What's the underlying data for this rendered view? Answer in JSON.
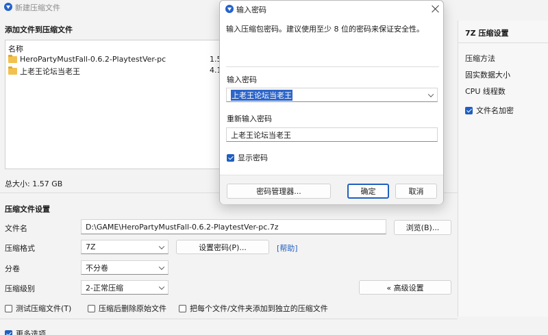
{
  "window": {
    "title": "新建压缩文件",
    "add_files_heading": "添加文件到压缩文件",
    "list_header_name": "名称",
    "files": [
      {
        "name": "HeroPartyMustFall-0.6.2-PlaytestVer-pc",
        "size": "1.5"
      },
      {
        "name": "上老王论坛当老王",
        "size": "4.1"
      }
    ],
    "total_size": "总大小: 1.57 GB",
    "settings_heading": "压缩文件设置",
    "filename_label": "文件名",
    "filename_value": "D:\\GAME\\HeroPartyMustFall-0.6.2-PlaytestVer-pc.7z",
    "browse_button": "浏览(B)...",
    "format_label": "压缩格式",
    "format_value": "7Z",
    "set_password_button": "设置密码(P)...",
    "help_link": "[帮助]",
    "volume_label": "分卷",
    "volume_value": "不分卷",
    "level_label": "压缩级别",
    "level_value": "2-正常压缩",
    "advanced_button": "« 高级设置",
    "test_checkbox": "测试压缩文件(T)",
    "delete_checkbox": "压缩后删除原始文件",
    "separate_checkbox": "把每个文件/文件夹添加到独立的压缩文件",
    "more_options": "更多选项"
  },
  "right_panel": {
    "heading": "7Z 压缩设置",
    "method": "压缩方法",
    "solid": "固实数据大小",
    "threads": "CPU 线程数",
    "encrypt_names": "文件名加密"
  },
  "dialog": {
    "title": "输入密码",
    "instruction": "输入压缩包密码。建议使用至少 8 位的密码来保证安全性。",
    "password_label": "输入密码",
    "password_value": "上老王论坛当老王",
    "confirm_label": "重新输入密码",
    "confirm_value": "上老王论坛当老王",
    "show_password": "显示密码",
    "manager_button": "密码管理器...",
    "ok_button": "确定",
    "cancel_button": "取消"
  },
  "colors": {
    "accent": "#1f5fbf",
    "selection": "#2d65c8",
    "folder": "#f2c14e"
  }
}
